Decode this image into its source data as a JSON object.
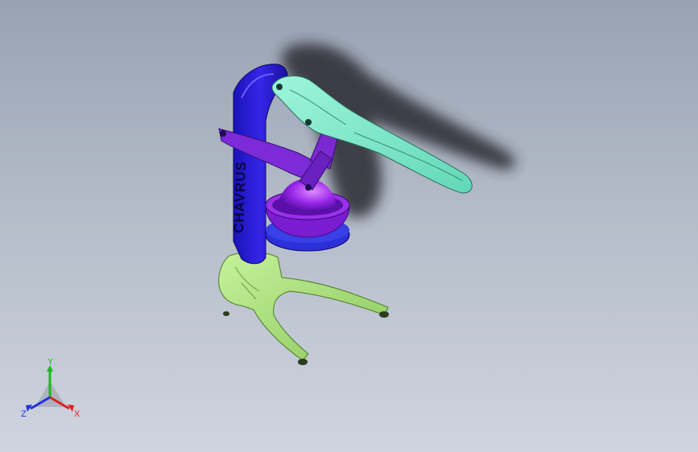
{
  "model": {
    "brand_text": "CHAVRUS",
    "parts": [
      {
        "name": "frame",
        "color": "#2f1fd6"
      },
      {
        "name": "top-bowl",
        "color": "#8a22e6"
      },
      {
        "name": "bottom-bowl",
        "color": "#2b30d8"
      },
      {
        "name": "upper-link",
        "color": "#7d2ad8"
      },
      {
        "name": "lever-handle",
        "color": "#7ee8c8"
      },
      {
        "name": "base-legs",
        "color": "#a9e07a"
      }
    ]
  },
  "triad": {
    "x_label": "X",
    "y_label": "Y",
    "z_label": "Z",
    "x_color": "#e02020",
    "y_color": "#1cb81c",
    "z_color": "#2030e0"
  }
}
